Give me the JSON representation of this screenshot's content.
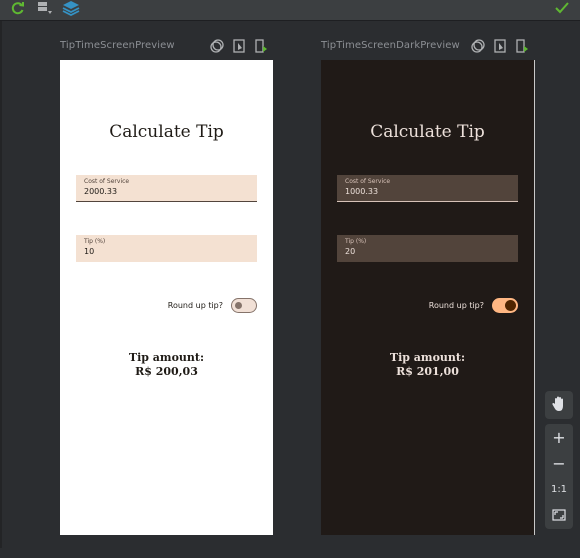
{
  "toolbar": {
    "refresh_icon": "refresh-icon",
    "layout_icon": "layout-icon",
    "layers_icon": "layers-icon",
    "status_icon": "checkmark-icon",
    "accent_green": "#5fb832",
    "accent_blue": "#3592c4"
  },
  "previews": [
    {
      "name": "TipTimeScreenPreview",
      "theme": "light",
      "title": "Calculate Tip",
      "cost_label": "Cost of Service",
      "cost_value": "2000.33",
      "tip_label": "Tip (%)",
      "tip_value": "10",
      "round_label": "Round up tip?",
      "round_up": false,
      "tip_amount_label": "Tip amount:",
      "tip_amount_value": "R$ 200,03"
    },
    {
      "name": "TipTimeScreenDarkPreview",
      "theme": "dark",
      "title": "Calculate Tip",
      "cost_label": "Cost of Service",
      "cost_value": "1000.33",
      "tip_label": "Tip (%)",
      "tip_value": "20",
      "round_label": "Round up tip?",
      "round_up": true,
      "tip_amount_label": "Tip amount:",
      "tip_amount_value": "R$ 201,00"
    }
  ],
  "zoom_controls": {
    "pan_icon": "hand-icon",
    "zoom_in": "+",
    "zoom_out": "−",
    "actual_size": "1:1",
    "fit_icon": "fit-screen-icon"
  }
}
